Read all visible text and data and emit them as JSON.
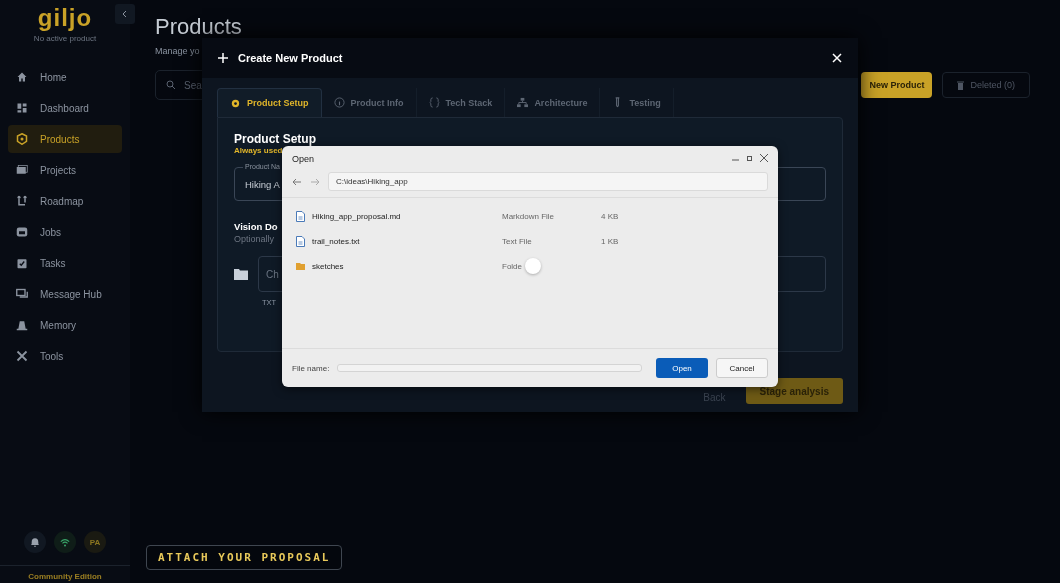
{
  "sidebar": {
    "logo": "giljo",
    "status": "No active product",
    "items": [
      {
        "label": "Home",
        "selected": false
      },
      {
        "label": "Dashboard",
        "selected": false
      },
      {
        "label": "Products",
        "selected": true
      },
      {
        "label": "Projects",
        "selected": false
      },
      {
        "label": "Roadmap",
        "selected": false
      },
      {
        "label": "Jobs",
        "selected": false
      },
      {
        "label": "Tasks",
        "selected": false
      },
      {
        "label": "Message Hub",
        "selected": false
      },
      {
        "label": "Memory",
        "selected": false
      },
      {
        "label": "Tools",
        "selected": false
      }
    ],
    "avatar": "PA",
    "edition": "Community Edition"
  },
  "page": {
    "title": "Products",
    "subtitle": "Manage yo",
    "search_placeholder": "Sea",
    "new_button": "New Product",
    "deleted_button": "Deleted (0)"
  },
  "modal": {
    "title": "Create New Product",
    "tabs": [
      {
        "label": "Product Setup",
        "selected": true
      },
      {
        "label": "Product Info",
        "selected": false
      },
      {
        "label": "Tech Stack",
        "selected": false
      },
      {
        "label": "Architecture",
        "selected": false
      },
      {
        "label": "Testing",
        "selected": false
      }
    ],
    "heading": "Product Setup",
    "note": "Always used",
    "name_label": "Product Na",
    "name_value": "Hiking A",
    "vision_heading": "Vision Do",
    "vision_hint": "Optionally",
    "file_placeholder": "Ch",
    "file_hint": "TXT",
    "back": "Back",
    "next": "Stage analysis"
  },
  "dialog": {
    "title": "Open",
    "path": "C:\\ideas\\Hiking_app",
    "files": [
      {
        "kind": "file",
        "name": "Hiking_app_proposal.md",
        "type": "Markdown File",
        "size": "4 KB"
      },
      {
        "kind": "file",
        "name": "trail_notes.txt",
        "type": "Text File",
        "size": "1 KB"
      },
      {
        "kind": "folder",
        "name": "sketches",
        "type": "Folde"
      }
    ],
    "file_name_label": "File name:",
    "open": "Open",
    "cancel": "Cancel"
  },
  "caption": "ATTACH YOUR PROPOSAL"
}
